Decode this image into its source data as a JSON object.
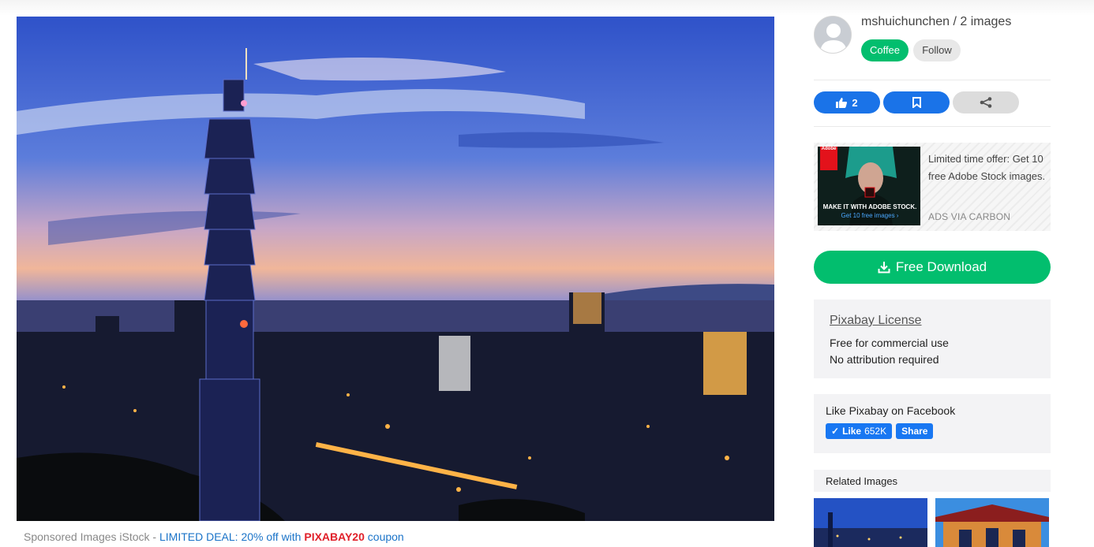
{
  "photo": {
    "alt": "Taipei 101 skyline at dusk"
  },
  "sponsor": {
    "prefix": "Sponsored Images iStock - ",
    "deal": "LIMITED DEAL: 20% off with ",
    "code": "PIXABAY20",
    "suffix": " coupon"
  },
  "author": {
    "line": "mshuichunchen / 2 images",
    "coffee_label": "Coffee",
    "follow_label": "Follow"
  },
  "actions": {
    "like_count": "2"
  },
  "ad": {
    "logo_text": "Adobe",
    "tagline": "MAKE IT WITH ADOBE STOCK.",
    "sub": "Get 10 free images ›",
    "text": "Limited time offer: Get 10 free Adobe Stock images.",
    "via": "ADS VIA CARBON"
  },
  "download": {
    "label": "Free Download"
  },
  "license": {
    "title": "Pixabay License",
    "line1": "Free for commercial use",
    "line2": "No attribution required"
  },
  "facebook": {
    "title": "Like Pixabay on Facebook",
    "like_label": "Like",
    "like_count": "652K",
    "share_label": "Share"
  },
  "related": {
    "title": "Related Images"
  },
  "colors": {
    "green": "#02be6e",
    "blue": "#1a73e8",
    "facebook": "#1877f2",
    "deal_red": "#e0202a"
  }
}
